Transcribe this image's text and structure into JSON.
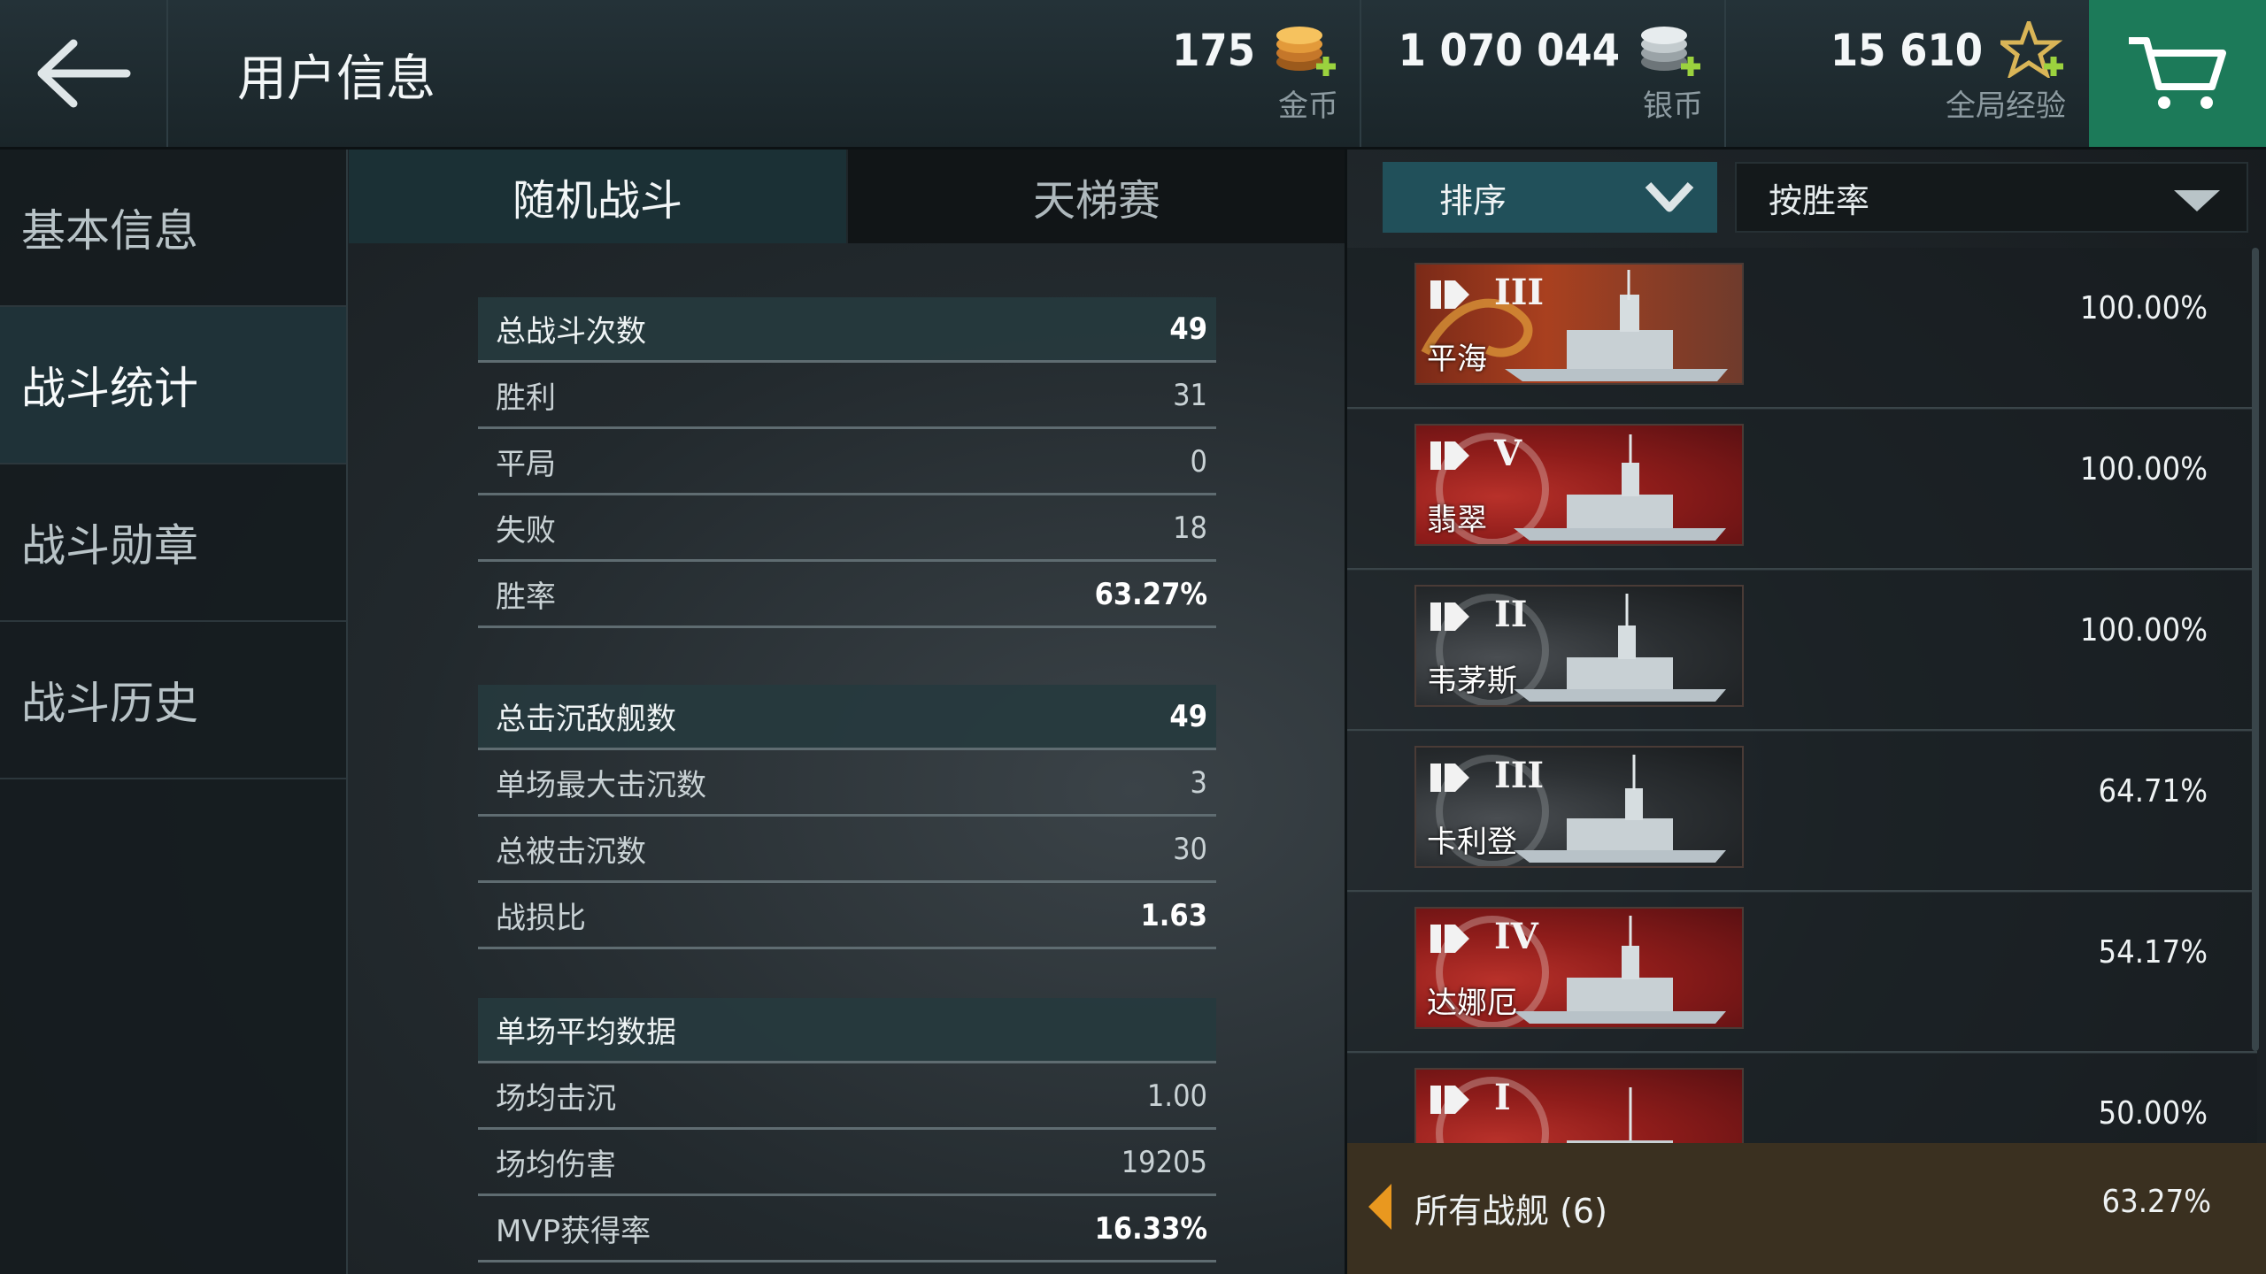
{
  "header": {
    "title": "用户信息",
    "gold": {
      "value": "175",
      "label": "金币",
      "icon": "gold-coins-plus-icon"
    },
    "silver": {
      "value": "1 070 044",
      "label": "银币",
      "icon": "silver-coins-plus-icon"
    },
    "xp": {
      "value": "15 610",
      "label": "全局经验",
      "icon": "star-plus-icon"
    },
    "cart_icon": "cart-icon",
    "back_icon": "back-arrow-icon"
  },
  "sidebar": {
    "items": [
      {
        "label": "基本信息",
        "active": false
      },
      {
        "label": "战斗统计",
        "active": true
      },
      {
        "label": "战斗勋章",
        "active": false
      },
      {
        "label": "战斗历史",
        "active": false
      }
    ]
  },
  "tabs": [
    {
      "label": "随机战斗",
      "active": true
    },
    {
      "label": "天梯赛",
      "active": false
    }
  ],
  "stats": {
    "battles": {
      "header": {
        "label": "总战斗次数",
        "value": "49"
      },
      "rows": [
        {
          "label": "胜利",
          "value": "31"
        },
        {
          "label": "平局",
          "value": "0"
        },
        {
          "label": "失败",
          "value": "18"
        },
        {
          "label": "胜率",
          "value": "63.27%"
        }
      ]
    },
    "kills": {
      "header": {
        "label": "总击沉敌舰数",
        "value": "49"
      },
      "rows": [
        {
          "label": "单场最大击沉数",
          "value": "3"
        },
        {
          "label": "总被击沉数",
          "value": "30"
        },
        {
          "label": "战损比",
          "value": "1.63"
        }
      ]
    },
    "averages": {
      "header": {
        "label": "单场平均数据",
        "value": ""
      },
      "rows": [
        {
          "label": "场均击沉",
          "value": "1.00"
        },
        {
          "label": "场均伤害",
          "value": "19205"
        },
        {
          "label": "MVP获得率",
          "value": "16.33%"
        }
      ]
    }
  },
  "sort": {
    "label": "排序",
    "order": "按胜率"
  },
  "ships": [
    {
      "name": "平海",
      "tier": "III",
      "rate": "100.00%",
      "style": "gold"
    },
    {
      "name": "翡翠",
      "tier": "V",
      "rate": "100.00%",
      "style": "red"
    },
    {
      "name": "韦茅斯",
      "tier": "II",
      "rate": "100.00%",
      "style": "dark"
    },
    {
      "name": "卡利登",
      "tier": "III",
      "rate": "64.71%",
      "style": "dark"
    },
    {
      "name": "达娜厄",
      "tier": "IV",
      "rate": "54.17%",
      "style": "red"
    },
    {
      "name": "",
      "tier": "I",
      "rate": "50.00%",
      "style": "red"
    }
  ],
  "footer": {
    "label": "所有战舰 (6)",
    "rate": "63.27%"
  }
}
